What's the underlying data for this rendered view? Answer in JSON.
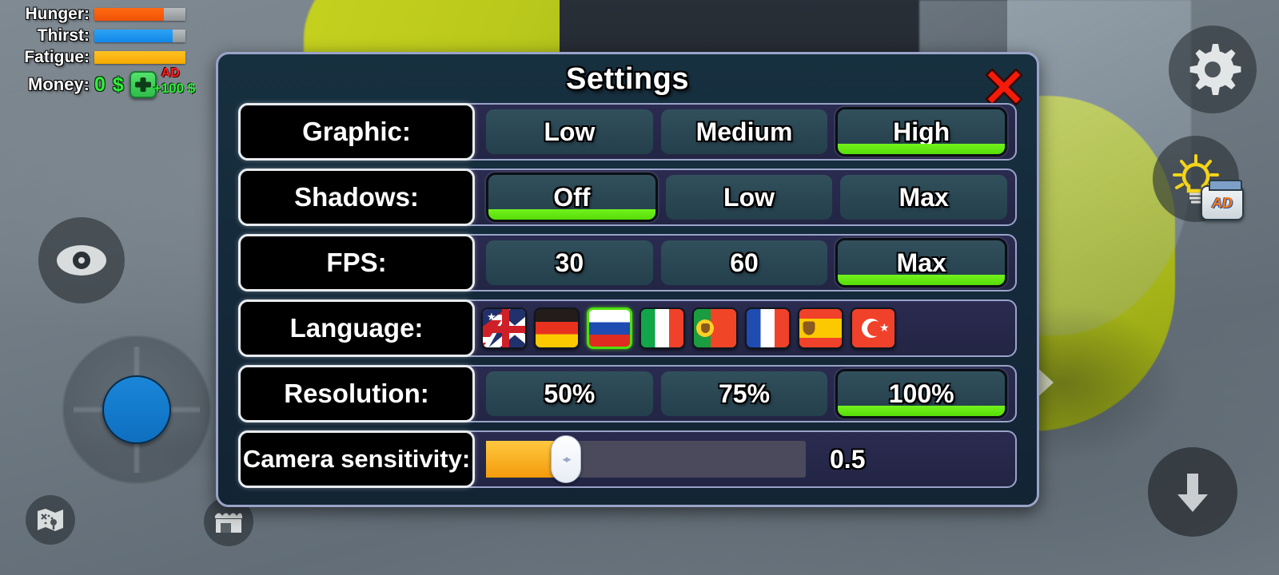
{
  "hud": {
    "stats": [
      {
        "label": "Hunger:",
        "fill_pct": 76,
        "color": "#ff6a11",
        "name": "hunger"
      },
      {
        "label": "Thirst:",
        "fill_pct": 86,
        "color": "#2da3f5",
        "name": "thirst"
      },
      {
        "label": "Fatigue:",
        "fill_pct": 100,
        "color": "#ffc224",
        "name": "fatigue"
      }
    ],
    "money": {
      "label": "Money:",
      "amount": "0 $",
      "ad_tag": "AD",
      "ad_reward": "+100 $",
      "plus_icon": "plus-icon"
    },
    "buttons": {
      "eye": "eye-icon",
      "joystick": "joystick-control",
      "map": "map-icon",
      "shop": "shop-icon",
      "gear": "gear-icon",
      "light": "lightbulb-icon",
      "down": "arrow-down-icon",
      "ad_chip": "AD"
    }
  },
  "dialog": {
    "title": "Settings",
    "close_icon": "close-x-icon",
    "rows": [
      {
        "label": "Graphic:",
        "type": "options",
        "options": [
          "Low",
          "Medium",
          "High"
        ],
        "selected": 2
      },
      {
        "label": "Shadows:",
        "type": "options",
        "options": [
          "Off",
          "Low",
          "Max"
        ],
        "selected": 0
      },
      {
        "label": "FPS:",
        "type": "options",
        "options": [
          "30",
          "60",
          "Max"
        ],
        "selected": 2
      },
      {
        "label": "Language:",
        "type": "flags",
        "flags": [
          {
            "name": "english",
            "class": "f-usuk"
          },
          {
            "name": "german",
            "class": "f-de"
          },
          {
            "name": "russian",
            "class": "f-ru"
          },
          {
            "name": "italian",
            "class": "f-it"
          },
          {
            "name": "portuguese",
            "class": "f-pt"
          },
          {
            "name": "french",
            "class": "f-fr"
          },
          {
            "name": "spanish",
            "class": "f-es"
          },
          {
            "name": "turkish",
            "class": "f-tr"
          }
        ],
        "selected": 2
      },
      {
        "label": "Resolution:",
        "type": "options",
        "options": [
          "50%",
          "75%",
          "100%"
        ],
        "selected": 2
      },
      {
        "label": "Camera sensitivity:",
        "type": "slider",
        "value": "0.5",
        "fill_pct": 25
      }
    ]
  },
  "colors": {
    "accent_green": "#57dd08",
    "panel_border": "#9aa3c8",
    "option_fill": "#2a4653",
    "close_red": "#f51b0a",
    "slider_orange": "#f59b0c"
  }
}
